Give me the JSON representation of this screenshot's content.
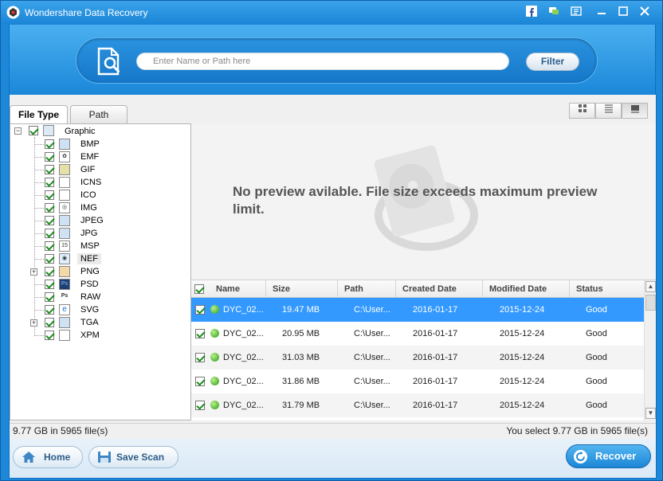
{
  "app": {
    "title": "Wondershare Data Recovery"
  },
  "search": {
    "placeholder": "Enter Name or Path here",
    "filter_label": "Filter"
  },
  "tabs": [
    {
      "label": "File Type"
    },
    {
      "label": "Path"
    }
  ],
  "tree": {
    "root": "Graphic",
    "items": [
      {
        "label": "BMP",
        "icon": "bmp-icon"
      },
      {
        "label": "EMF",
        "icon": "emf-icon"
      },
      {
        "label": "GIF",
        "icon": "gif-icon"
      },
      {
        "label": "ICNS",
        "icon": "icns-icon"
      },
      {
        "label": "ICO",
        "icon": "ico-icon"
      },
      {
        "label": "IMG",
        "icon": "img-icon"
      },
      {
        "label": "JPEG",
        "icon": "jpeg-icon"
      },
      {
        "label": "JPG",
        "icon": "jpg-icon"
      },
      {
        "label": "MSP",
        "icon": "msp-icon"
      },
      {
        "label": "NEF",
        "icon": "nef-icon"
      },
      {
        "label": "PNG",
        "icon": "png-icon"
      },
      {
        "label": "PSD",
        "icon": "psd-icon"
      },
      {
        "label": "RAW",
        "icon": "raw-icon"
      },
      {
        "label": "SVG",
        "icon": "svg-icon"
      },
      {
        "label": "TGA",
        "icon": "tga-icon"
      },
      {
        "label": "XPM",
        "icon": "xpm-icon"
      }
    ]
  },
  "preview": {
    "message": "No preview avilable. File size exceeds maximum preview limit."
  },
  "grid": {
    "columns": [
      "Name",
      "Size",
      "Path",
      "Created Date",
      "Modified Date",
      "Status"
    ],
    "rows": [
      {
        "name": "DYC_02...",
        "size": "19.47 MB",
        "path": "C:\\User...",
        "created": "2016-01-17",
        "modified": "2015-12-24",
        "status": "Good"
      },
      {
        "name": "DYC_02...",
        "size": "20.95 MB",
        "path": "C:\\User...",
        "created": "2016-01-17",
        "modified": "2015-12-24",
        "status": "Good"
      },
      {
        "name": "DYC_02...",
        "size": "31.03 MB",
        "path": "C:\\User...",
        "created": "2016-01-17",
        "modified": "2015-12-24",
        "status": "Good"
      },
      {
        "name": "DYC_02...",
        "size": "31.86 MB",
        "path": "C:\\User...",
        "created": "2016-01-17",
        "modified": "2015-12-24",
        "status": "Good"
      },
      {
        "name": "DYC_02...",
        "size": "31.79 MB",
        "path": "C:\\User...",
        "created": "2016-01-17",
        "modified": "2015-12-24",
        "status": "Good"
      }
    ]
  },
  "status": {
    "left": "9.77 GB in 5965 file(s)",
    "right": "You select 9.77 GB in 5965 file(s)"
  },
  "footer": {
    "home_label": "Home",
    "save_scan_label": "Save Scan",
    "recover_label": "Recover"
  },
  "colors": {
    "accent": "#1d88d8",
    "selection": "#3399ff",
    "status_good": "#2d9b17"
  }
}
